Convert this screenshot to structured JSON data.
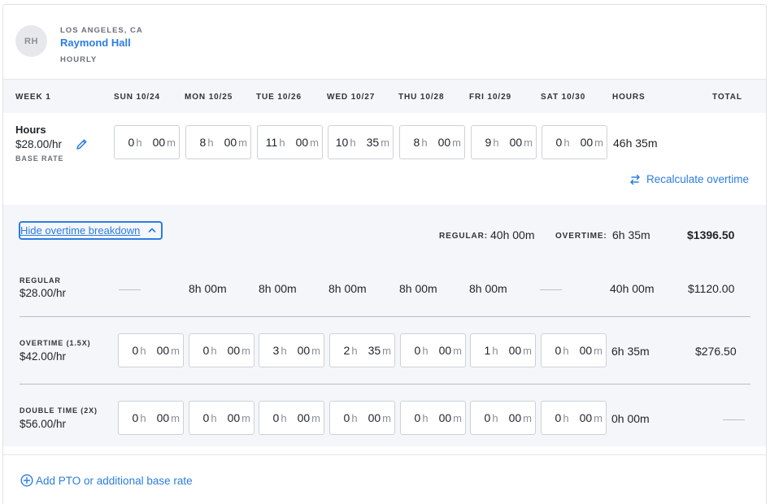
{
  "employee": {
    "initials": "RH",
    "location": "LOS ANGELES, CA",
    "name": "Raymond Hall",
    "pay_type": "HOURLY"
  },
  "week_header": {
    "week": "WEEK 1",
    "days": [
      "SUN 10/24",
      "MON 10/25",
      "TUE 10/26",
      "WED 10/27",
      "THU 10/28",
      "FRI 10/29",
      "SAT 10/30"
    ],
    "hours": "HOURS",
    "total": "TOTAL"
  },
  "hours_row": {
    "label": "Hours",
    "rate": "$28.00/hr",
    "rate_label": "BASE RATE",
    "entries": [
      {
        "h": "0",
        "m": "00"
      },
      {
        "h": "8",
        "m": "00"
      },
      {
        "h": "11",
        "m": "00"
      },
      {
        "h": "10",
        "m": "35"
      },
      {
        "h": "8",
        "m": "00"
      },
      {
        "h": "9",
        "m": "00"
      },
      {
        "h": "0",
        "m": "00"
      }
    ],
    "total_hours": "46h 35m",
    "unit_h": "h",
    "unit_m": "m"
  },
  "recalculate_label": "Recalculate overtime",
  "breakdown": {
    "hide_label": "Hide overtime breakdown",
    "regular_label": "REGULAR:",
    "regular_value": "40h 00m",
    "overtime_label": "OVERTIME:",
    "overtime_value": "6h 35m",
    "grand_total": "$1396.50",
    "regular": {
      "label": "REGULAR",
      "rate": "$28.00/hr",
      "days": [
        "——",
        "8h 00m",
        "8h 00m",
        "8h 00m",
        "8h 00m",
        "8h 00m",
        "——"
      ],
      "hours": "40h 00m",
      "total": "$1120.00"
    },
    "overtime": {
      "label": "OVERTIME (1.5X)",
      "rate": "$42.00/hr",
      "entries": [
        {
          "h": "0",
          "m": "00"
        },
        {
          "h": "0",
          "m": "00"
        },
        {
          "h": "3",
          "m": "00"
        },
        {
          "h": "2",
          "m": "35"
        },
        {
          "h": "0",
          "m": "00"
        },
        {
          "h": "1",
          "m": "00"
        },
        {
          "h": "0",
          "m": "00"
        }
      ],
      "hours": "6h 35m",
      "total": "$276.50"
    },
    "double_time": {
      "label": "DOUBLE TIME (2X)",
      "rate": "$56.00/hr",
      "entries": [
        {
          "h": "0",
          "m": "00"
        },
        {
          "h": "0",
          "m": "00"
        },
        {
          "h": "0",
          "m": "00"
        },
        {
          "h": "0",
          "m": "00"
        },
        {
          "h": "0",
          "m": "00"
        },
        {
          "h": "0",
          "m": "00"
        },
        {
          "h": "0",
          "m": "00"
        }
      ],
      "hours": "0h 00m",
      "total": "——"
    }
  },
  "add_pto_label": "Add PTO or additional base rate",
  "colors": {
    "accent": "#2b7de1",
    "panel": "#f4f6f9",
    "border": "#cdd2d8"
  }
}
